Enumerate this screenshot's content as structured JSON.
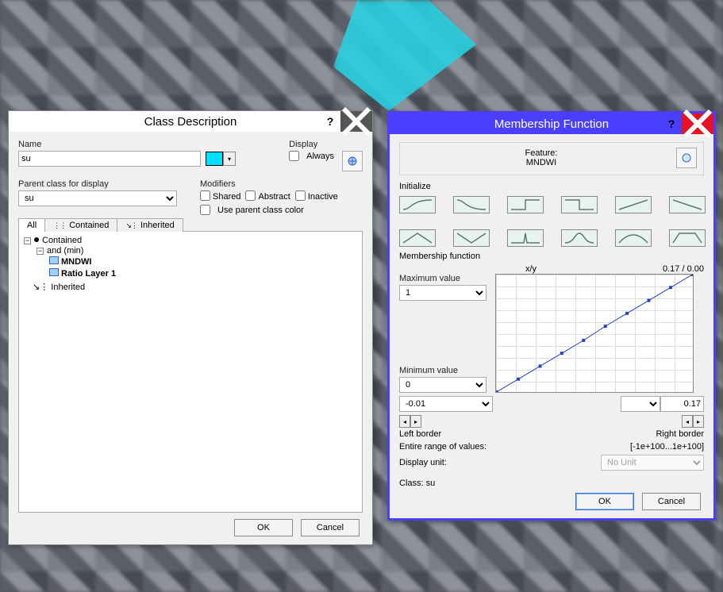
{
  "classDesc": {
    "title": "Class Description",
    "nameLabel": "Name",
    "nameValue": "su",
    "displayLabel": "Display",
    "alwaysLabel": "Always",
    "parentLabel": "Parent class for display",
    "parentValue": "su",
    "modLabel": "Modifiers",
    "sharedLabel": "Shared",
    "abstractLabel": "Abstract",
    "inactiveLabel": "Inactive",
    "parentColorLabel": "Use parent class color",
    "tabs": {
      "all": "All",
      "contained": "Contained",
      "inherited": "Inherited"
    },
    "tree": {
      "contained": "Contained",
      "andmin": "and (min)",
      "mndwi": "MNDWI",
      "ratio": "Ratio Layer 1",
      "inherited": "Inherited"
    },
    "ok": "OK",
    "cancel": "Cancel"
  },
  "mf": {
    "title": "Membership Function",
    "featureLabel": "Feature:",
    "featureName": "MNDWI",
    "initLabel": "Initialize",
    "mfLabel": "Membership function",
    "maxLabel": "Maximum value",
    "maxValue": "1",
    "minLabel": "Minimum value",
    "minValue": "0",
    "xyLabel": "x/y",
    "xyValue": "0.17 / 0.00",
    "leftBorderValue": "-0.01",
    "rightBorderValue": "0.17",
    "leftBorderLabel": "Left border",
    "rightBorderLabel": "Right border",
    "rangeLabel": "Entire range of values:",
    "rangeValue": "[-1e+100...1e+100]",
    "dispUnitLabel": "Display unit:",
    "dispUnitValue": "No Unit",
    "classLabel": "Class:",
    "classValue": "su",
    "ok": "OK",
    "cancel": "Cancel"
  },
  "chart_data": {
    "type": "line",
    "title": "Membership Function",
    "xlabel": "x",
    "ylabel": "y",
    "xlim": [
      -0.01,
      0.17
    ],
    "ylim": [
      0,
      1
    ],
    "x": [
      -0.01,
      0.01,
      0.03,
      0.05,
      0.07,
      0.09,
      0.11,
      0.13,
      0.15,
      0.17
    ],
    "values": [
      0.0,
      0.11,
      0.22,
      0.33,
      0.44,
      0.56,
      0.67,
      0.78,
      0.89,
      1.0
    ]
  }
}
